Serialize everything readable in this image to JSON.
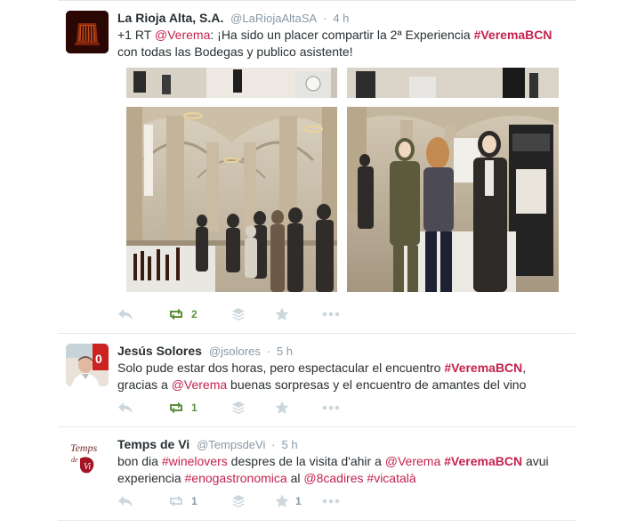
{
  "colors": {
    "link": "#c4224f",
    "retweet_green": "#5c913b",
    "icon_grey": "#ccd6dd",
    "meta_grey": "#8899a6"
  },
  "tweets": [
    {
      "fullname": "La Rioja Alta, S.A.",
      "username": "@LaRiojaAltaSA",
      "dot": "·",
      "time": "4 h",
      "text": [
        {
          "t": "+1 RT "
        },
        {
          "t": "@Verema",
          "type": "mention"
        },
        {
          "t": ": ¡Ha sido un placer compartir la 2ª Experiencia "
        },
        {
          "t": "#VeremaBCN",
          "type": "hashtag"
        },
        {
          "t": " con todas las Bodegas y publico asistente!"
        }
      ],
      "retweets": "2",
      "favorites": ""
    },
    {
      "fullname": "Jesús Solores",
      "username": "@jsolores",
      "dot": "·",
      "time": "5 h",
      "text": [
        {
          "t": "Solo pude estar dos horas, pero espectacular el encuentro "
        },
        {
          "t": "#VeremaBCN",
          "type": "hashtag"
        },
        {
          "t": ", gracias a "
        },
        {
          "t": "@Verema",
          "type": "mention"
        },
        {
          "t": " buenas sorpresas y el encuentro de amantes del vino"
        }
      ],
      "retweets": "1",
      "favorites": ""
    },
    {
      "fullname": "Temps de Vi",
      "username": "@TempsdeVi",
      "dot": "·",
      "time": "5 h",
      "avatar_text": "Temps de Vi",
      "text": [
        {
          "t": "bon dia "
        },
        {
          "t": "#winelovers",
          "type": "hashtag"
        },
        {
          "t": " despres de la visita d'ahir a "
        },
        {
          "t": "@Verema",
          "type": "mention"
        },
        {
          "t": " "
        },
        {
          "t": "#VeremaBCN",
          "type": "hashtag"
        },
        {
          "t": " avui experiencia "
        },
        {
          "t": "#enogastronomica",
          "type": "hashtag"
        },
        {
          "t": " al "
        },
        {
          "t": "@8cadires",
          "type": "mention"
        },
        {
          "t": " "
        },
        {
          "t": "#vicatalà",
          "type": "hashtag"
        }
      ],
      "retweets": "1",
      "favorites": "1"
    }
  ]
}
